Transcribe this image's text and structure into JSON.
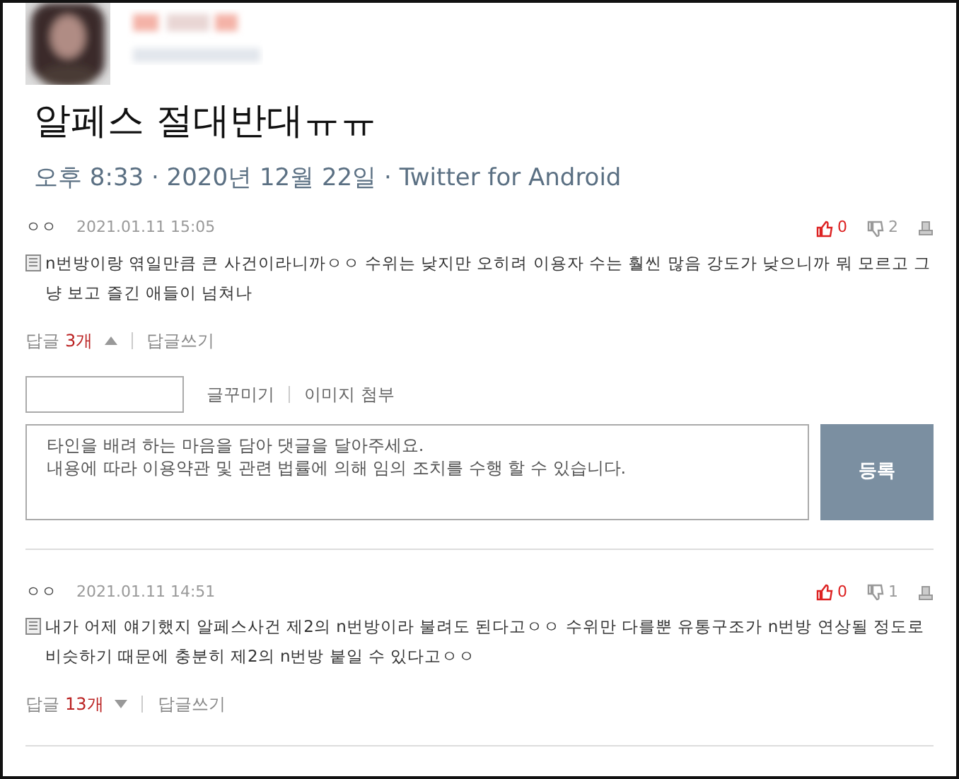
{
  "tweet": {
    "text": "알페스 절대반대ㅠㅠ",
    "meta": "오후 8:33 · 2020년 12월 22일 · Twitter for Android"
  },
  "comments": [
    {
      "author": "ㅇㅇ",
      "date": "2021.01.11 15:05",
      "likes": "0",
      "dislikes": "2",
      "text": "n번방이랑 엮일만큼 큰 사건이라니까ㅇㅇ 수위는 낮지만 오히려 이용자 수는 훨씬 많음 강도가 낮으니까 뭐 모르고 그냥 보고 즐긴 애들이 넘쳐나",
      "replies_label": "답글",
      "replies_count": "3개",
      "expanded": true,
      "write_reply": "답글쓰기",
      "editor": {
        "decorate": "글꾸미기",
        "attach": "이미지 첨부",
        "placeholder": "타인을 배려 하는 마음을 담아 댓글을 달아주세요.\n내용에 따라 이용약관 및 관련 법률에 의해 임의 조치를 수행 할 수 있습니다.",
        "submit": "등록"
      }
    },
    {
      "author": "ㅇㅇ",
      "date": "2021.01.11 14:51",
      "likes": "0",
      "dislikes": "1",
      "text": "내가 어제 얘기했지 알페스사건 제2의 n번방이라 불려도 된다고ㅇㅇ 수위만 다를뿐 유통구조가 n번방 연상될 정도로 비슷하기 때문에 충분히 제2의 n번방 붙일 수 있다고ㅇㅇ",
      "replies_label": "답글",
      "replies_count": "13개",
      "expanded": false,
      "write_reply": "답글쓰기"
    }
  ]
}
